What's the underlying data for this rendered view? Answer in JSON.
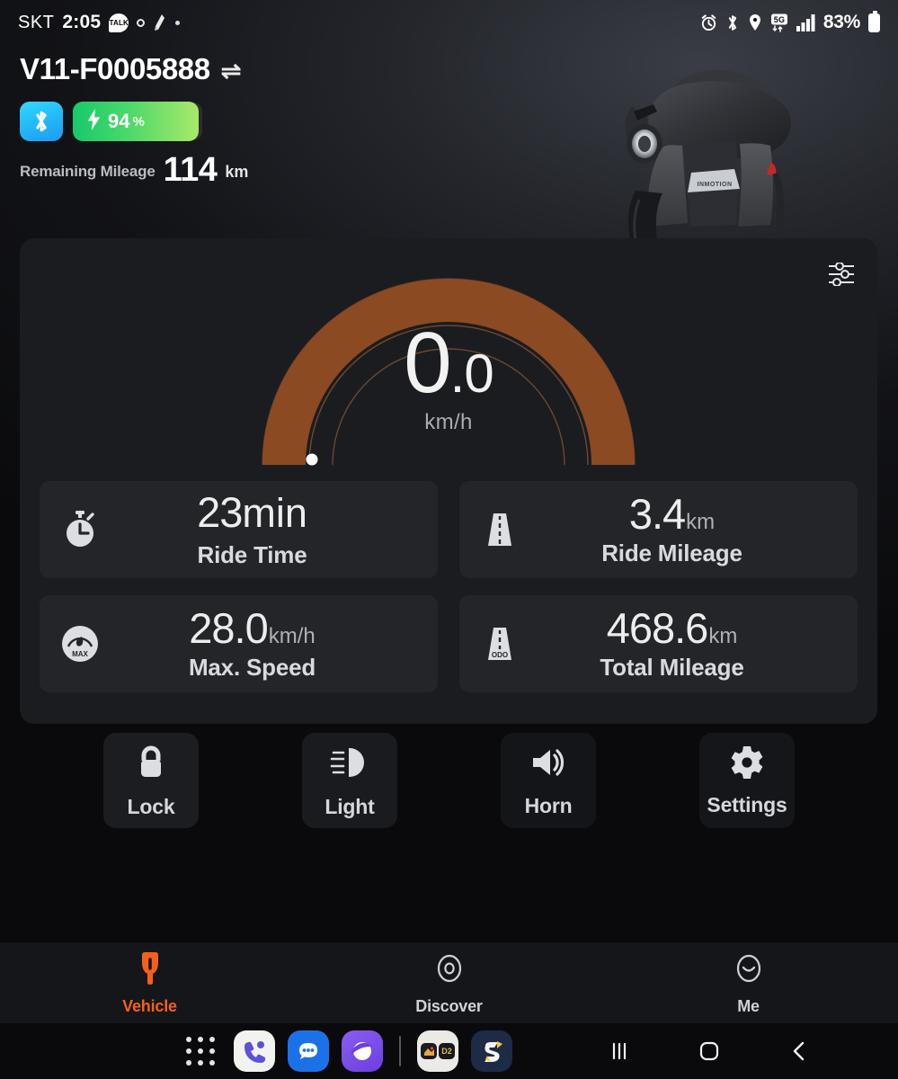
{
  "statusbar": {
    "carrier": "SKT",
    "time": "2:05",
    "kakao_label": "TALK",
    "icons_left": [
      "kakaotalk-icon",
      "circle-icon",
      "note-icon",
      "dot-icon"
    ],
    "icons_right": [
      "alarm-icon",
      "bluetooth-icon",
      "location-icon",
      "5g-icon",
      "signal-icon"
    ],
    "network": "5G",
    "battery_percent": "83%"
  },
  "device": {
    "name": "V11-F0005888",
    "switch_icon": "⇌",
    "bluetooth_icon": "bluetooth-icon",
    "battery": {
      "value": "94",
      "symbol": "%",
      "bolt_icon": "bolt-icon",
      "fill_percent": 94,
      "color": "#4cd96a"
    },
    "remaining_mileage": {
      "label": "Remaining Mileage",
      "value": "114",
      "unit": "km"
    },
    "photo_alt": "electric-unicycle"
  },
  "dashboard": {
    "tune_icon": "sliders-icon",
    "speed": {
      "integer": "0",
      "decimal": ".0",
      "unit": "km/h",
      "value": 0.0,
      "max": 50,
      "arc_color": "#8c4a22",
      "track_color": "#2a2118"
    },
    "stats": [
      {
        "icon": "stopwatch-icon",
        "value": "23",
        "unit": "min",
        "unit_inline": true,
        "caption": "Ride Time"
      },
      {
        "icon": "road-icon",
        "value": "3.4",
        "unit": "km",
        "unit_inline": false,
        "caption": "Ride Mileage"
      },
      {
        "icon": "max-gauge-icon",
        "value": "28.0",
        "unit": "km/h",
        "unit_inline": false,
        "caption": "Max. Speed"
      },
      {
        "icon": "odo-road-icon",
        "value": "468.6",
        "unit": "km",
        "unit_inline": false,
        "caption": "Total Mileage"
      }
    ]
  },
  "actions": [
    {
      "icon": "lock-icon",
      "label": "Lock"
    },
    {
      "icon": "headlight-icon",
      "label": "Light"
    },
    {
      "icon": "horn-icon",
      "label": "Horn"
    },
    {
      "icon": "gear-icon",
      "label": "Settings"
    }
  ],
  "bottom_nav": {
    "active_color": "#f4601a",
    "items": [
      {
        "icon": "vehicle-icon",
        "label": "Vehicle",
        "active": true
      },
      {
        "icon": "discover-icon",
        "label": "Discover",
        "active": false
      },
      {
        "icon": "me-icon",
        "label": "Me",
        "active": false
      }
    ]
  },
  "taskbar": {
    "apps": [
      "app-drawer-icon",
      "phone-icon",
      "messages-icon",
      "internet-icon",
      "divider",
      "app-folder-icon",
      "samsung-notes-icon"
    ],
    "nav_keys": [
      "recents-key",
      "home-key",
      "back-key"
    ]
  }
}
